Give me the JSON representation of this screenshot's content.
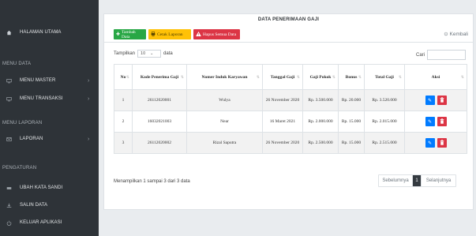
{
  "sidebar": {
    "home": {
      "label": "HALAMAN UTAMA",
      "icon": "home-icon"
    },
    "section_data": "MENU DATA",
    "menu_master": {
      "label": "MENU MASTER",
      "icon": "monitor-icon"
    },
    "menu_transaksi": {
      "label": "MENU TRANSAKSI",
      "icon": "monitor-icon"
    },
    "section_laporan": "MENU LAPORAN",
    "laporan": {
      "label": "LAPORAN",
      "icon": "mail-icon"
    },
    "section_pengaturan": "PENGATURAN",
    "ubah_sandi": {
      "label": "UBAH KATA SANDI",
      "icon": "key-icon"
    },
    "salin_data": {
      "label": "SALIN DATA",
      "icon": "download-icon"
    },
    "keluar": {
      "label": "KELUAR APLIKASI",
      "icon": "power-icon"
    }
  },
  "page": {
    "title": "DATA PENERIMAAN GAJI",
    "btn_tambah": "Tambah Data",
    "btn_cetak": "Cetak Laporan",
    "btn_hapus": "Hapus Semua Data",
    "kembali": "Kembali"
  },
  "table_controls": {
    "tampilkan": "Tampilkan",
    "page_size": "10",
    "data_label": "data",
    "cari": "Cari",
    "search_value": ""
  },
  "table": {
    "headers": [
      "No",
      "Kode Penerima Gaji",
      "Nomer Induk Karyawan",
      "Tanggal Gaji",
      "Gaji Pokok",
      "Bonus",
      "Total Gaji",
      "Aksi"
    ],
    "rows": [
      {
        "no": "1",
        "kode": "26112020001",
        "nama": "Wulya",
        "tanggal": "26 November 2020",
        "pokok": "Rp. 3.500.000",
        "bonus": "Rp. 20.000",
        "total": "Rp. 3.520.000"
      },
      {
        "no": "2",
        "kode": "16032021003",
        "nama": "Near",
        "tanggal": "16 Maret 2021",
        "pokok": "Rp. 2.000.000",
        "bonus": "Rp. 15.000",
        "total": "Rp. 2.015.000"
      },
      {
        "no": "3",
        "kode": "26112020002",
        "nama": "Rizal Saputra",
        "tanggal": "26 November 2020",
        "pokok": "Rp. 2.500.000",
        "bonus": "Rp. 15.000",
        "total": "Rp. 2.515.000"
      }
    ]
  },
  "footer": {
    "info": "Menampilkan 1 sampai 3 dari 3 data",
    "prev": "Sebelumnya",
    "current": "1",
    "next": "Selanjutnya"
  },
  "colors": {
    "sidebar_bg": "#2e3338",
    "success": "#28a745",
    "warning": "#ffc107",
    "danger": "#dc3545",
    "primary": "#007bff"
  }
}
